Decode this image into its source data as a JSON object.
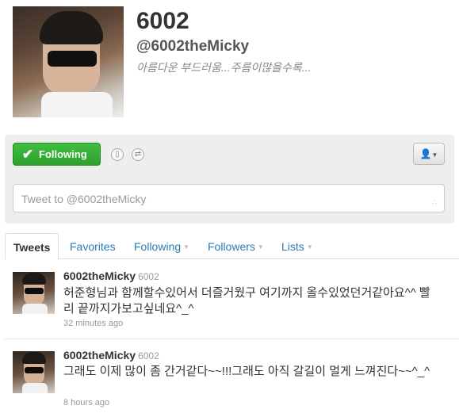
{
  "profile": {
    "name": "6002",
    "handle": "@6002theMicky",
    "bio": "아름다운 부드러움...주름이많을수록..."
  },
  "actions": {
    "follow_label": "Following",
    "tweet_placeholder": "Tweet to @6002theMicky"
  },
  "tabs": [
    {
      "label": "Tweets"
    },
    {
      "label": "Favorites"
    },
    {
      "label": "Following"
    },
    {
      "label": "Followers"
    },
    {
      "label": "Lists"
    }
  ],
  "tweets": [
    {
      "user": "6002theMicky",
      "screen_name": "6002",
      "text": "허준형님과 함께할수있어서 더즐거웠구 여기까지 올수있었던거같아요^^ 빨리 끝까지가보고싶네요^_^",
      "time": "32 minutes ago"
    },
    {
      "user": "6002theMicky",
      "screen_name": "6002",
      "text": "그래도 이제 많이 좀 간거같다~~!!!그래도 아직 갈길이 멀게 느껴진다~~^_^",
      "time": "8 hours ago"
    }
  ],
  "colors": {
    "follow_green": "#36b036",
    "link_blue": "#2b7bb9"
  },
  "icons": {
    "follow": "check-icon",
    "device": "mobile-icon",
    "retweet": "retweet-icon",
    "user_menu": "user-icon"
  }
}
